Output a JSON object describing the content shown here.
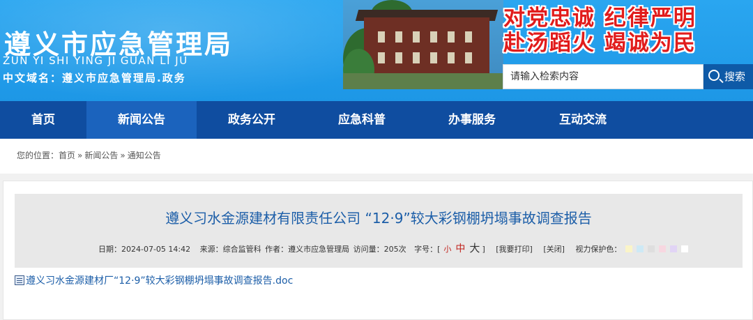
{
  "header": {
    "site_title": "遵义市应急管理局",
    "site_pinyin": "ZUN YI SHI YING JI GUAN LI JU",
    "site_domain": "中文域名：遵义市应急管理局.政务",
    "slogan_line1": "对党忠诚 纪律严明",
    "slogan_line2": "赴汤蹈火 竭诚为民",
    "search_placeholder": "请输入检索内容",
    "search_button": "搜索"
  },
  "nav": {
    "items": [
      {
        "label": "首页"
      },
      {
        "label": "新闻公告"
      },
      {
        "label": "政务公开"
      },
      {
        "label": "应急科普"
      },
      {
        "label": "办事服务"
      },
      {
        "label": "互动交流"
      }
    ],
    "active_index": 1
  },
  "breadcrumb": {
    "prefix": "您的位置：",
    "items": [
      "首页",
      "新闻公告",
      "通知公告"
    ],
    "separator": "»"
  },
  "article": {
    "title": "遵义习水金源建材有限责任公司 “12·9”较大彩钢棚坍塌事故调查报告",
    "meta": {
      "date": "日期：2024-07-05 14:42",
      "source": "来源：综合监管科",
      "author": "作者：遵义市应急管理局",
      "views": "访问量：205次",
      "font_size_label": "字号：[",
      "size_small": "小",
      "size_medium": "中",
      "size_large": "大",
      "bracket_close": "]",
      "print": "[我要打印]",
      "close": "[关闭]",
      "eye_care": "视力保护色："
    },
    "eye_care_colors": [
      "#FAF4C8",
      "#CDE9F5",
      "#DEDEDE",
      "#F7D7E0",
      "#E1D4F5",
      "#FFFFFF"
    ],
    "attachment": "遵义习水金源建材厂“12·9”较大彩钢棚坍塌事故调查报告.doc"
  },
  "colors": {
    "header_bg": "#1d97e6",
    "nav_bg": "#0f4da0",
    "nav_active": "#1b63bd",
    "title_color": "#1c5ea8",
    "slogan_color": "#e11c1c"
  }
}
